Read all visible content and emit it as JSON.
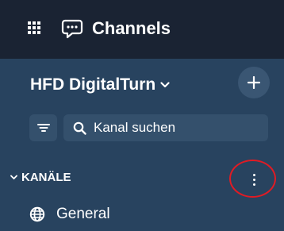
{
  "topbar": {
    "apps_icon": "grid-icon",
    "channels_icon": "chat-bubble-icon",
    "title": "Channels"
  },
  "workspace": {
    "name": "HFD DigitalTurn",
    "dropdown_icon": "chevron-down-icon",
    "add_icon": "plus-icon"
  },
  "search": {
    "filter_icon": "filter-icon",
    "search_icon": "search-icon",
    "placeholder": "Kanal suchen",
    "value": ""
  },
  "channels_section": {
    "collapse_icon": "chevron-down-icon",
    "title": "KANÄLE",
    "more_icon": "more-vertical-icon",
    "items": [
      {
        "icon": "globe-icon",
        "label": "General"
      }
    ]
  },
  "annotation": {
    "color": "#e01b24"
  },
  "colors": {
    "topbar_bg": "#1a2333",
    "sidebar_bg": "#28435f",
    "control_bg": "#34506c"
  }
}
